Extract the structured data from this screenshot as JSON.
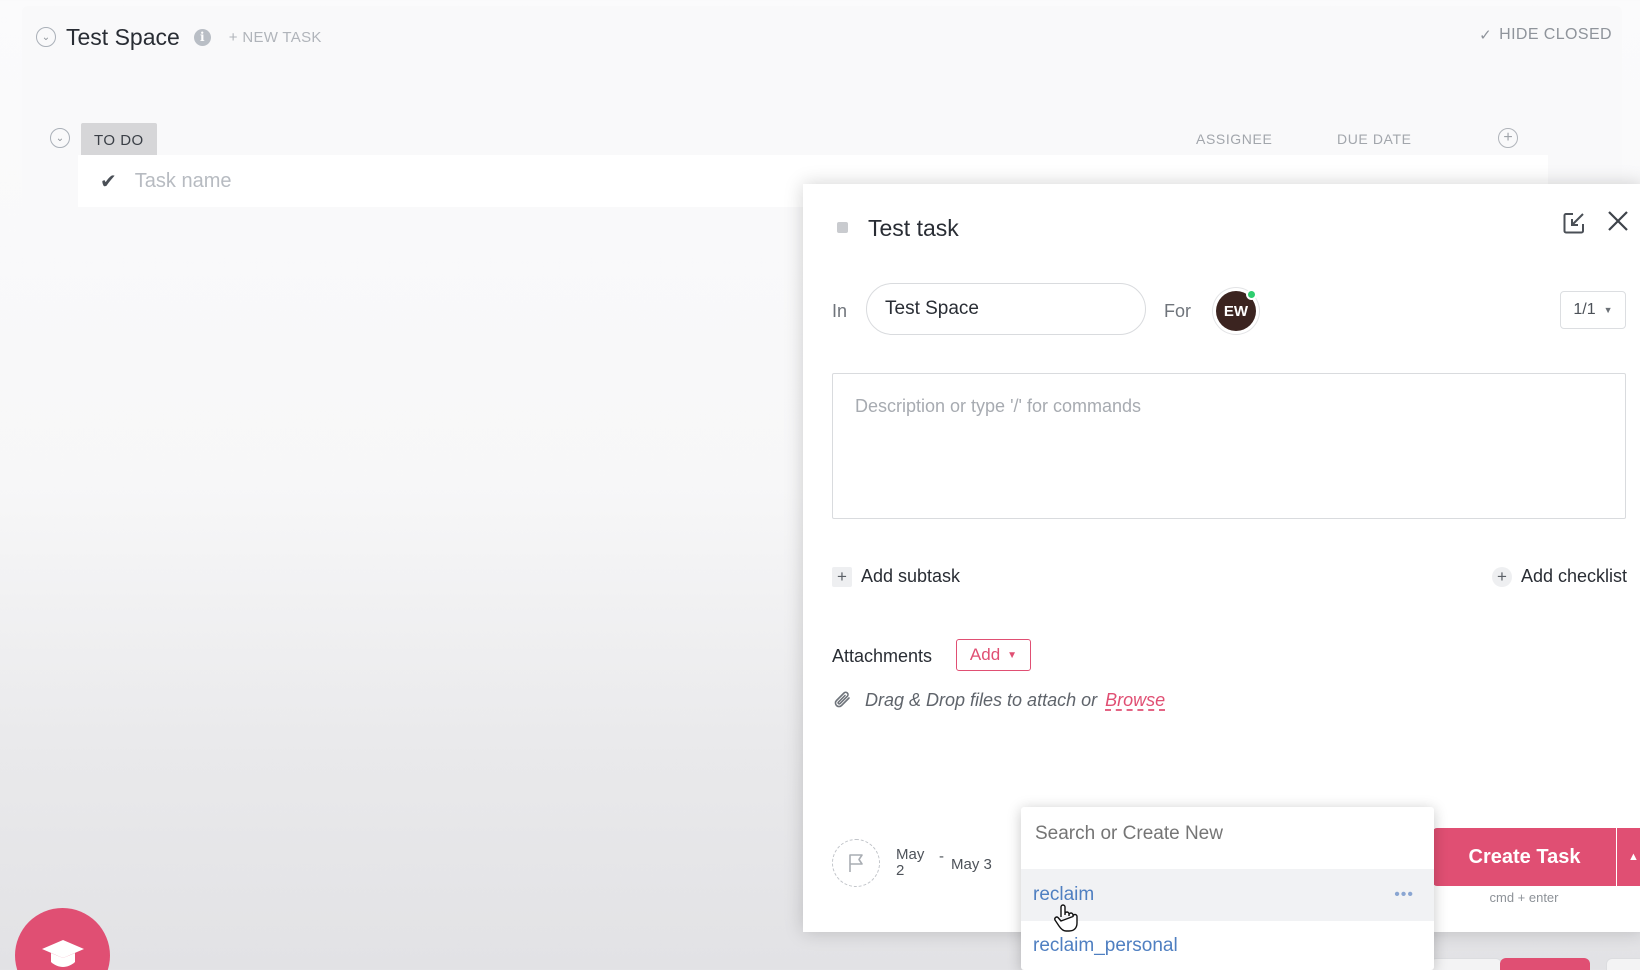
{
  "space": {
    "title": "Test Space",
    "new_task_label": "+ NEW TASK",
    "hide_closed_label": "HIDE CLOSED"
  },
  "group": {
    "status_label": "TO DO",
    "columns": [
      "ASSIGNEE",
      "DUE DATE"
    ],
    "task_name_placeholder": "Task name"
  },
  "modal": {
    "task_title": "Test task",
    "in_label": "In",
    "space_value": "Test Space",
    "for_label": "For",
    "assignee_initials": "EW",
    "page_counter": "1/1",
    "description_placeholder": "Description or type '/' for commands",
    "add_subtask_label": "Add subtask",
    "add_checklist_label": "Add checklist",
    "attachments_label": "Attachments",
    "add_button_label": "Add",
    "dropzone_text": "Drag & Drop files to attach or",
    "browse_label": "Browse",
    "start_date": "May 2",
    "date_separator": "-",
    "due_date": "May 3",
    "create_button_label": "Create Task",
    "create_hint": "cmd + enter"
  },
  "tag_dropdown": {
    "search_placeholder": "Search or Create New",
    "items": [
      "reclaim",
      "reclaim_personal"
    ],
    "more_label": "•••"
  },
  "colors": {
    "accent": "#e04f73",
    "tag_text": "#4f7fc1",
    "online": "#2ecd6f"
  }
}
